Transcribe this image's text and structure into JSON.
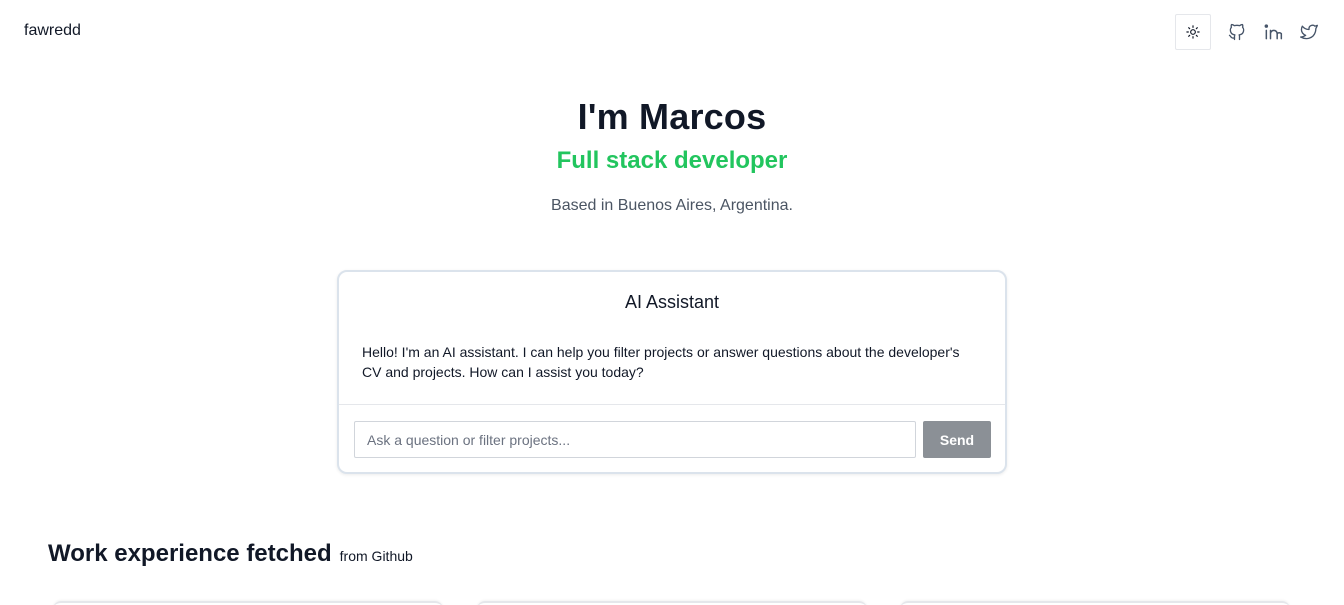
{
  "header": {
    "brand": "fawredd",
    "icons": {
      "theme": "sun-icon",
      "github": "github-icon",
      "linkedin": "linkedin-icon",
      "twitter": "twitter-icon"
    }
  },
  "hero": {
    "title": "I'm Marcos",
    "subtitle": "Full stack developer",
    "location": "Based in Buenos Aires, Argentina."
  },
  "assistant": {
    "title": "AI Assistant",
    "message": "Hello! I'm an AI assistant. I can help you filter projects or answer questions about the developer's CV and projects. How can I assist you today?",
    "input_placeholder": "Ask a question or filter projects...",
    "input_value": "",
    "send_label": "Send"
  },
  "work": {
    "title": "Work experience fetched",
    "source": "from Github"
  },
  "colors": {
    "accent": "#22c55e",
    "send_button": "#8b9096",
    "text": "#111827",
    "muted": "#4b5563",
    "icon": "#475569"
  }
}
